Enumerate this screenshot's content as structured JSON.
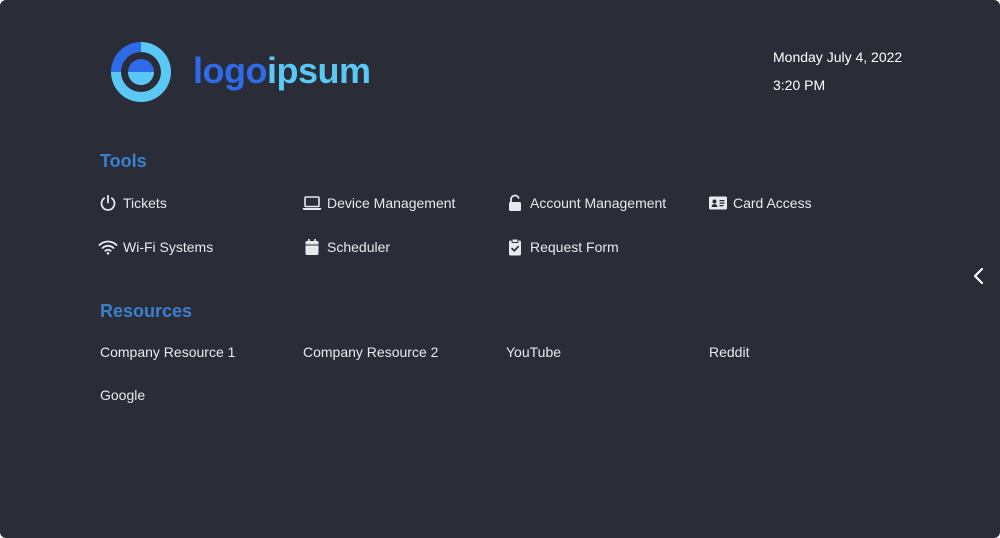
{
  "brand": {
    "logo_part1": "logo",
    "logo_part2": "ipsum",
    "colors": {
      "primary": "#2f6be8",
      "secondary": "#5ac8f5"
    }
  },
  "datetime": {
    "date": "Monday July 4, 2022",
    "time": "3:20 PM"
  },
  "tools": {
    "title": "Tools",
    "items": [
      {
        "label": "Tickets",
        "icon": "power-icon"
      },
      {
        "label": "Device Management",
        "icon": "laptop-icon"
      },
      {
        "label": "Account Management",
        "icon": "lock-icon"
      },
      {
        "label": "Card Access",
        "icon": "id-card-icon"
      },
      {
        "label": "Wi-Fi Systems",
        "icon": "wifi-icon"
      },
      {
        "label": "Scheduler",
        "icon": "calendar-icon"
      },
      {
        "label": "Request Form",
        "icon": "clipboard-check-icon"
      }
    ]
  },
  "resources": {
    "title": "Resources",
    "items": [
      {
        "label": "Company Resource 1"
      },
      {
        "label": "Company Resource 2"
      },
      {
        "label": "YouTube"
      },
      {
        "label": "Reddit"
      },
      {
        "label": "Google"
      }
    ]
  },
  "nav": {
    "collapse_icon": "chevron-left-icon"
  },
  "colors": {
    "background": "#2a2d38",
    "section_title": "#3d7fcf",
    "text": "#e8e9ec"
  }
}
